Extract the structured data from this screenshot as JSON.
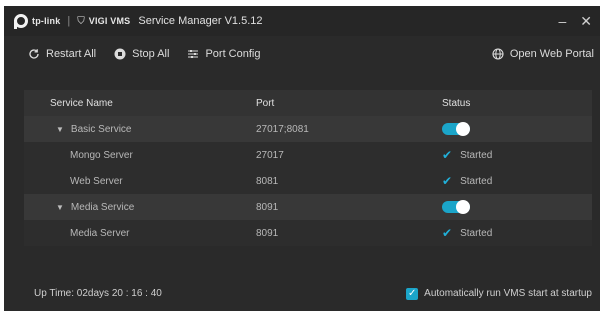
{
  "titlebar": {
    "brand": "tp-link",
    "product": "VIGI VMS",
    "app_title": "Service Manager V1.5.12",
    "minimize": "–",
    "close": "✕"
  },
  "toolbar": {
    "restart_all": "Restart All",
    "stop_all": "Stop All",
    "port_config": "Port Config",
    "open_web_portal": "Open Web Portal"
  },
  "table": {
    "headers": [
      "Service Name",
      "Port",
      "Status"
    ],
    "rows": [
      {
        "name": "Basic Service",
        "port": "27017;8081",
        "status": "",
        "toggle_on": true,
        "type": "group"
      },
      {
        "name": "Mongo Server",
        "port": "27017",
        "status": "Started",
        "type": "child"
      },
      {
        "name": "Web Server",
        "port": "8081",
        "status": "Started",
        "type": "child"
      },
      {
        "name": "Media Service",
        "port": "8091",
        "status": "",
        "toggle_on": true,
        "type": "group"
      },
      {
        "name": "Media Server",
        "port": "8091",
        "status": "Started",
        "type": "child"
      }
    ]
  },
  "footer": {
    "uptime": "Up Time: 02days 20 : 16 : 40",
    "autorun_label": "Automatically run VMS start at startup",
    "autorun_checked": true
  },
  "colors": {
    "accent": "#1ba5c9",
    "background": "#2a2a2a"
  }
}
